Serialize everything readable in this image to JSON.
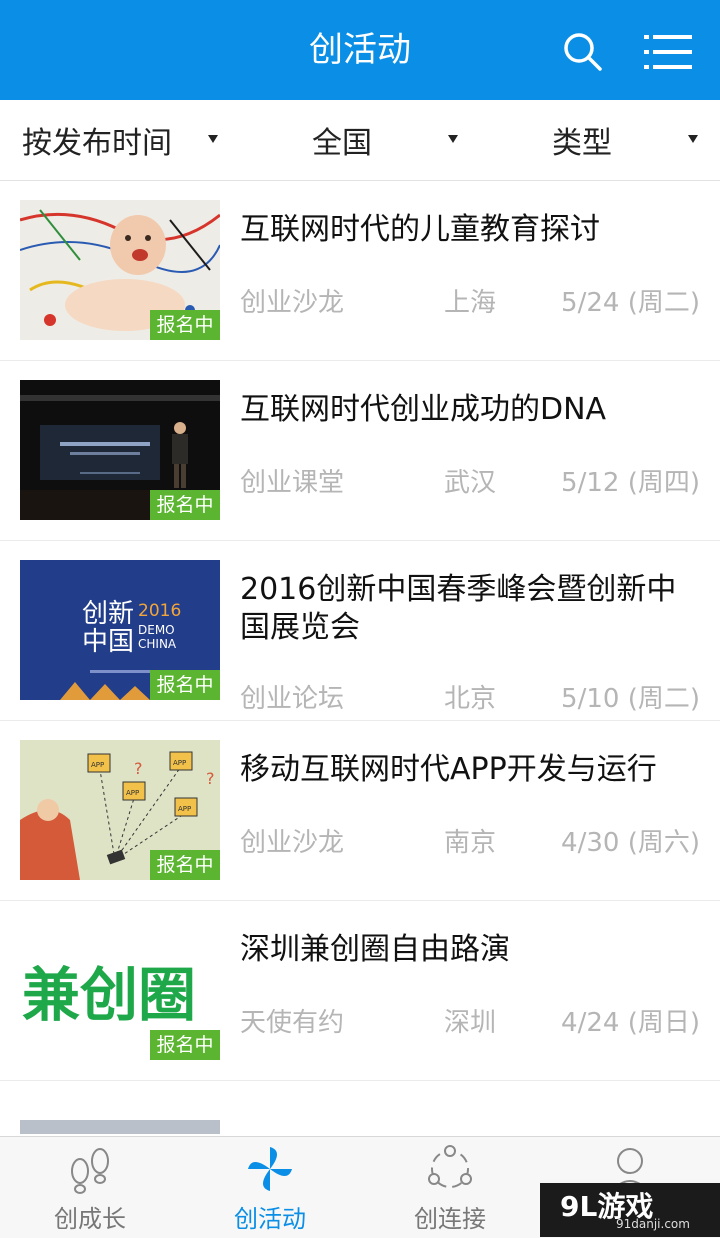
{
  "header": {
    "title": "创活动",
    "search_icon": "search-icon",
    "menu_icon": "menu-icon"
  },
  "filters": [
    {
      "label": "按发布时间"
    },
    {
      "label": "全国"
    },
    {
      "label": "类型"
    }
  ],
  "events": [
    {
      "title": "互联网时代的儿童教育探讨",
      "category": "创业沙龙",
      "city": "上海",
      "date": "5/24 (周二)",
      "badge": "报名中"
    },
    {
      "title": "互联网时代创业成功的DNA",
      "category": "创业课堂",
      "city": "武汉",
      "date": "5/12 (周四)",
      "badge": "报名中"
    },
    {
      "title": "2016创新中国春季峰会暨创新中国展览会",
      "category": "创业论坛",
      "city": "北京",
      "date": "5/10 (周二)",
      "badge": "报名中",
      "thumb_text_1": "创新",
      "thumb_text_2": "中国",
      "thumb_year": "2016",
      "thumb_brand_1": "DEMO",
      "thumb_brand_2": "CHINA"
    },
    {
      "title": "移动互联网时代APP开发与运行",
      "category": "创业沙龙",
      "city": "南京",
      "date": "4/30 (周六)",
      "badge": "报名中",
      "thumb_app": "APP",
      "thumb_q": "?"
    },
    {
      "title": "深圳兼创圈自由路演",
      "category": "天使有约",
      "city": "深圳",
      "date": "4/24 (周日)",
      "badge": "报名中",
      "thumb_logo": "兼创圈"
    }
  ],
  "bottom_nav": [
    {
      "label": "创成长",
      "icon": "footprints-icon",
      "active": false
    },
    {
      "label": "创活动",
      "icon": "pinwheel-icon",
      "active": true
    },
    {
      "label": "创连接",
      "icon": "share-icon",
      "active": false
    },
    {
      "label": "",
      "icon": "user-icon",
      "active": false
    }
  ],
  "watermark": {
    "main": "9L游戏",
    "sub": "91danji.com"
  },
  "colors": {
    "primary": "#0b8fe6",
    "badge": "#5cb531",
    "meta": "#b5b5b5"
  }
}
